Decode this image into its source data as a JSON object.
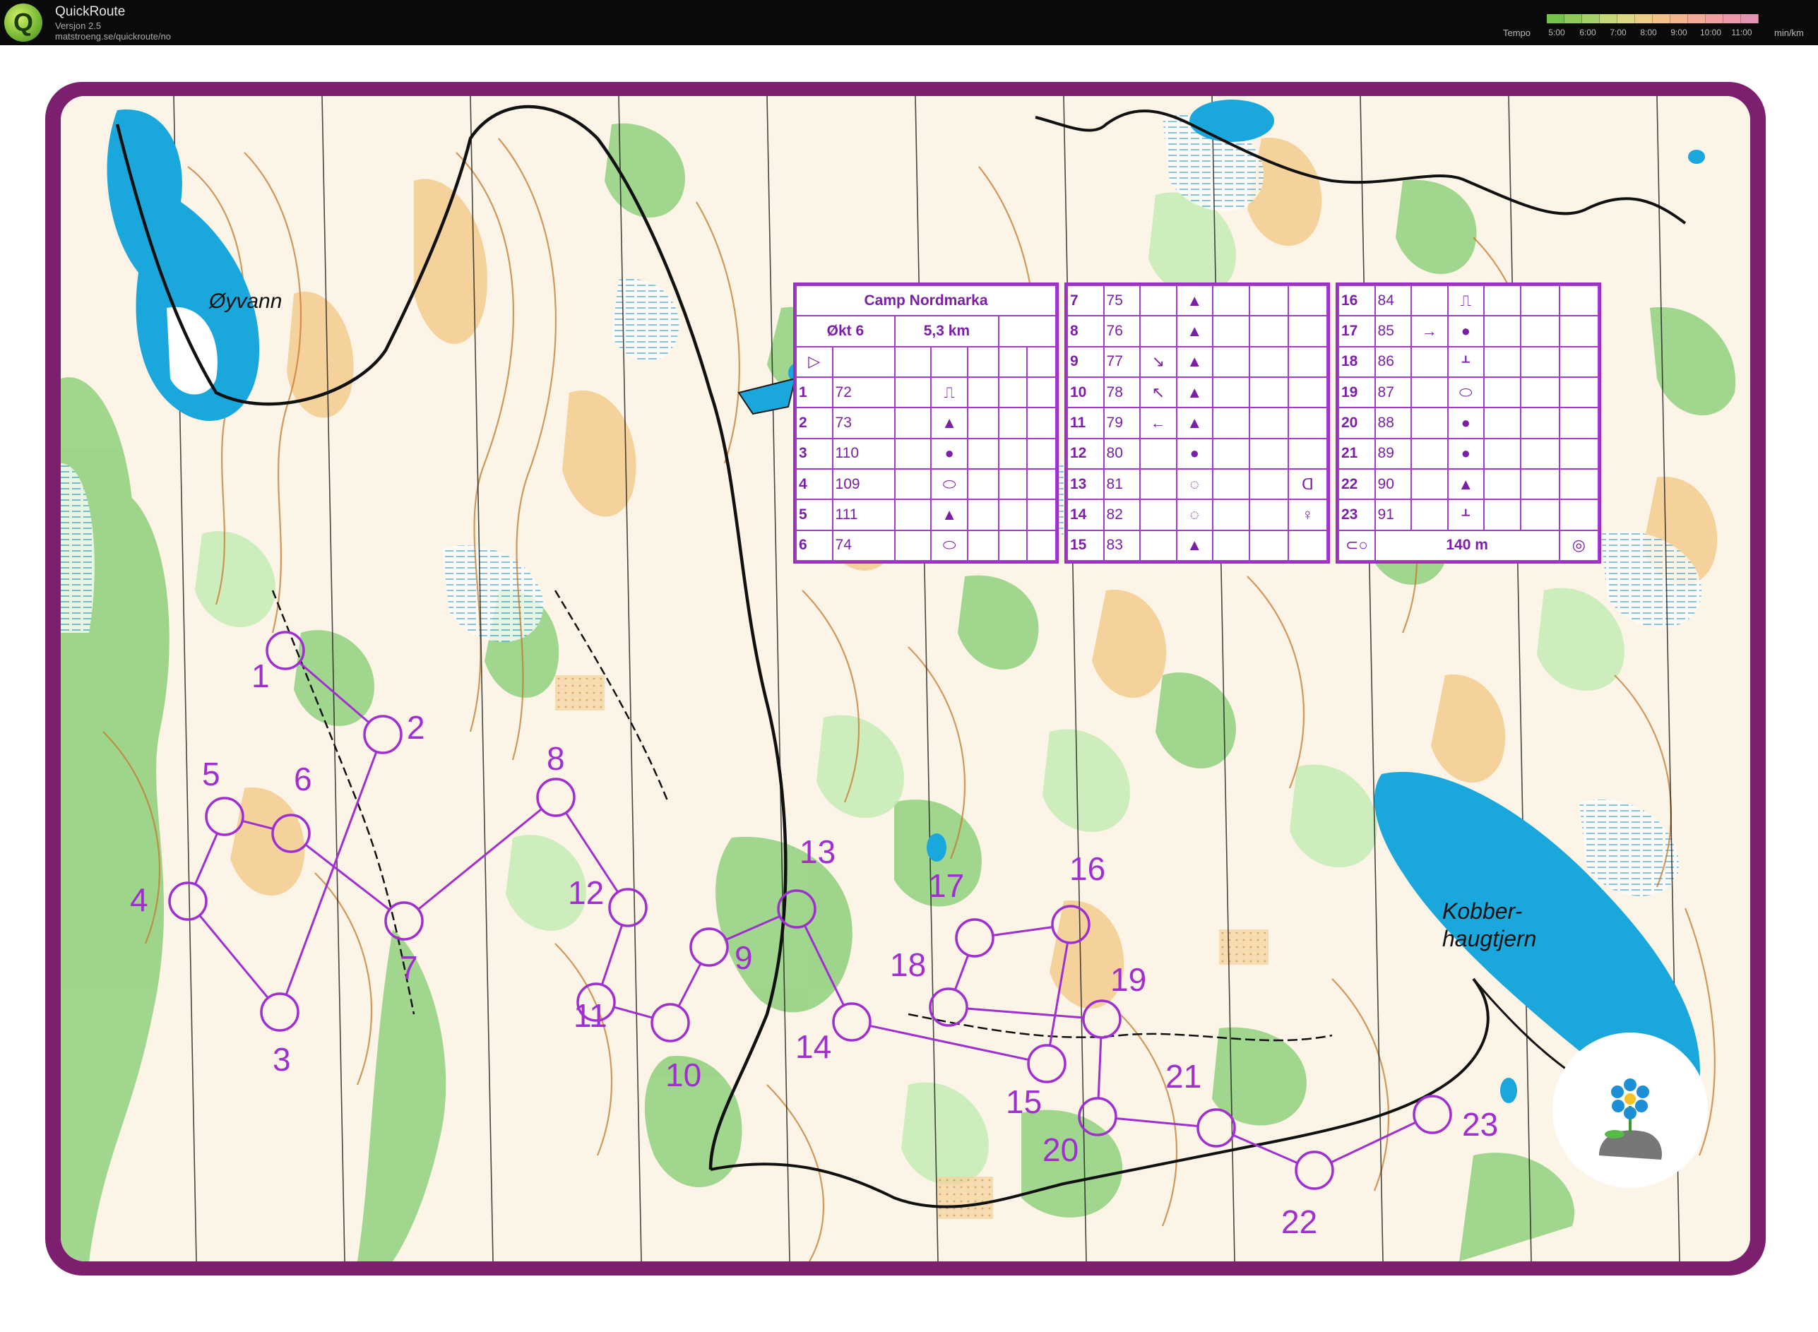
{
  "app": {
    "title": "QuickRoute",
    "version": "Versjon 2.5",
    "url": "matstroeng.se/quickroute/no",
    "logo_letter": "Q"
  },
  "tempo": {
    "label": "Tempo",
    "ticks": [
      "5:00",
      "6:00",
      "7:00",
      "8:00",
      "9:00",
      "10:00",
      "11:00"
    ],
    "unit": "min/km",
    "colors": [
      "#76c24a",
      "#8ec95a",
      "#a8d06a",
      "#c4d878",
      "#dcd884",
      "#ecce86",
      "#f2c28a",
      "#f4b590",
      "#f4aa98",
      "#f0a0a0",
      "#ec98a8",
      "#e294b4"
    ]
  },
  "map": {
    "frame_color": "#7d1f6f",
    "course_color": "#a02fd0",
    "lake_labels": [
      "Øyvann",
      "Kobber-",
      "haugtjern"
    ],
    "controls": [
      {
        "label": "1"
      },
      {
        "label": "2"
      },
      {
        "label": "3"
      },
      {
        "label": "4"
      },
      {
        "label": "5"
      },
      {
        "label": "6"
      },
      {
        "label": "7"
      },
      {
        "label": "8"
      },
      {
        "label": "9"
      },
      {
        "label": "10"
      },
      {
        "label": "11"
      },
      {
        "label": "12"
      },
      {
        "label": "13"
      },
      {
        "label": "14"
      },
      {
        "label": "15"
      },
      {
        "label": "16"
      },
      {
        "label": "17"
      },
      {
        "label": "18"
      },
      {
        "label": "19"
      },
      {
        "label": "20"
      },
      {
        "label": "21"
      },
      {
        "label": "22"
      },
      {
        "label": "23"
      }
    ]
  },
  "descriptions": {
    "event": "Camp Nordmarka",
    "session": "Økt 6",
    "length": "5,3 km",
    "finish_distance": "140 m",
    "start_symbol": "▷",
    "rows": [
      {
        "no": "1",
        "code": "72",
        "dir": "",
        "sym": "⎍"
      },
      {
        "no": "2",
        "code": "73",
        "dir": "",
        "sym": "▲"
      },
      {
        "no": "3",
        "code": "110",
        "dir": "",
        "sym": "●"
      },
      {
        "no": "4",
        "code": "109",
        "dir": "",
        "sym": "⬭"
      },
      {
        "no": "5",
        "code": "111",
        "dir": "",
        "sym": "▲"
      },
      {
        "no": "6",
        "code": "74",
        "dir": "",
        "sym": "⬭"
      },
      {
        "no": "7",
        "code": "75",
        "dir": "",
        "sym": "▲"
      },
      {
        "no": "8",
        "code": "76",
        "dir": "",
        "sym": "▲"
      },
      {
        "no": "9",
        "code": "77",
        "dir": "↘",
        "sym": "▲"
      },
      {
        "no": "10",
        "code": "78",
        "dir": "↖",
        "sym": "▲"
      },
      {
        "no": "11",
        "code": "79",
        "dir": "←",
        "sym": "▲"
      },
      {
        "no": "12",
        "code": "80",
        "dir": "",
        "sym": "●"
      },
      {
        "no": "13",
        "code": "81",
        "dir": "",
        "sym": "◌",
        "extra": "ᗡ"
      },
      {
        "no": "14",
        "code": "82",
        "dir": "",
        "sym": "◌",
        "extra": "♀"
      },
      {
        "no": "15",
        "code": "83",
        "dir": "",
        "sym": "▲"
      },
      {
        "no": "16",
        "code": "84",
        "dir": "",
        "sym": "⎍"
      },
      {
        "no": "17",
        "code": "85",
        "dir": "→",
        "sym": "●"
      },
      {
        "no": "18",
        "code": "86",
        "dir": "",
        "sym": "ᚆ"
      },
      {
        "no": "19",
        "code": "87",
        "dir": "",
        "sym": "⬭"
      },
      {
        "no": "20",
        "code": "88",
        "dir": "",
        "sym": "●"
      },
      {
        "no": "21",
        "code": "89",
        "dir": "",
        "sym": "●"
      },
      {
        "no": "22",
        "code": "90",
        "dir": "",
        "sym": "▲"
      },
      {
        "no": "23",
        "code": "91",
        "dir": "",
        "sym": "ᚆ"
      }
    ]
  }
}
